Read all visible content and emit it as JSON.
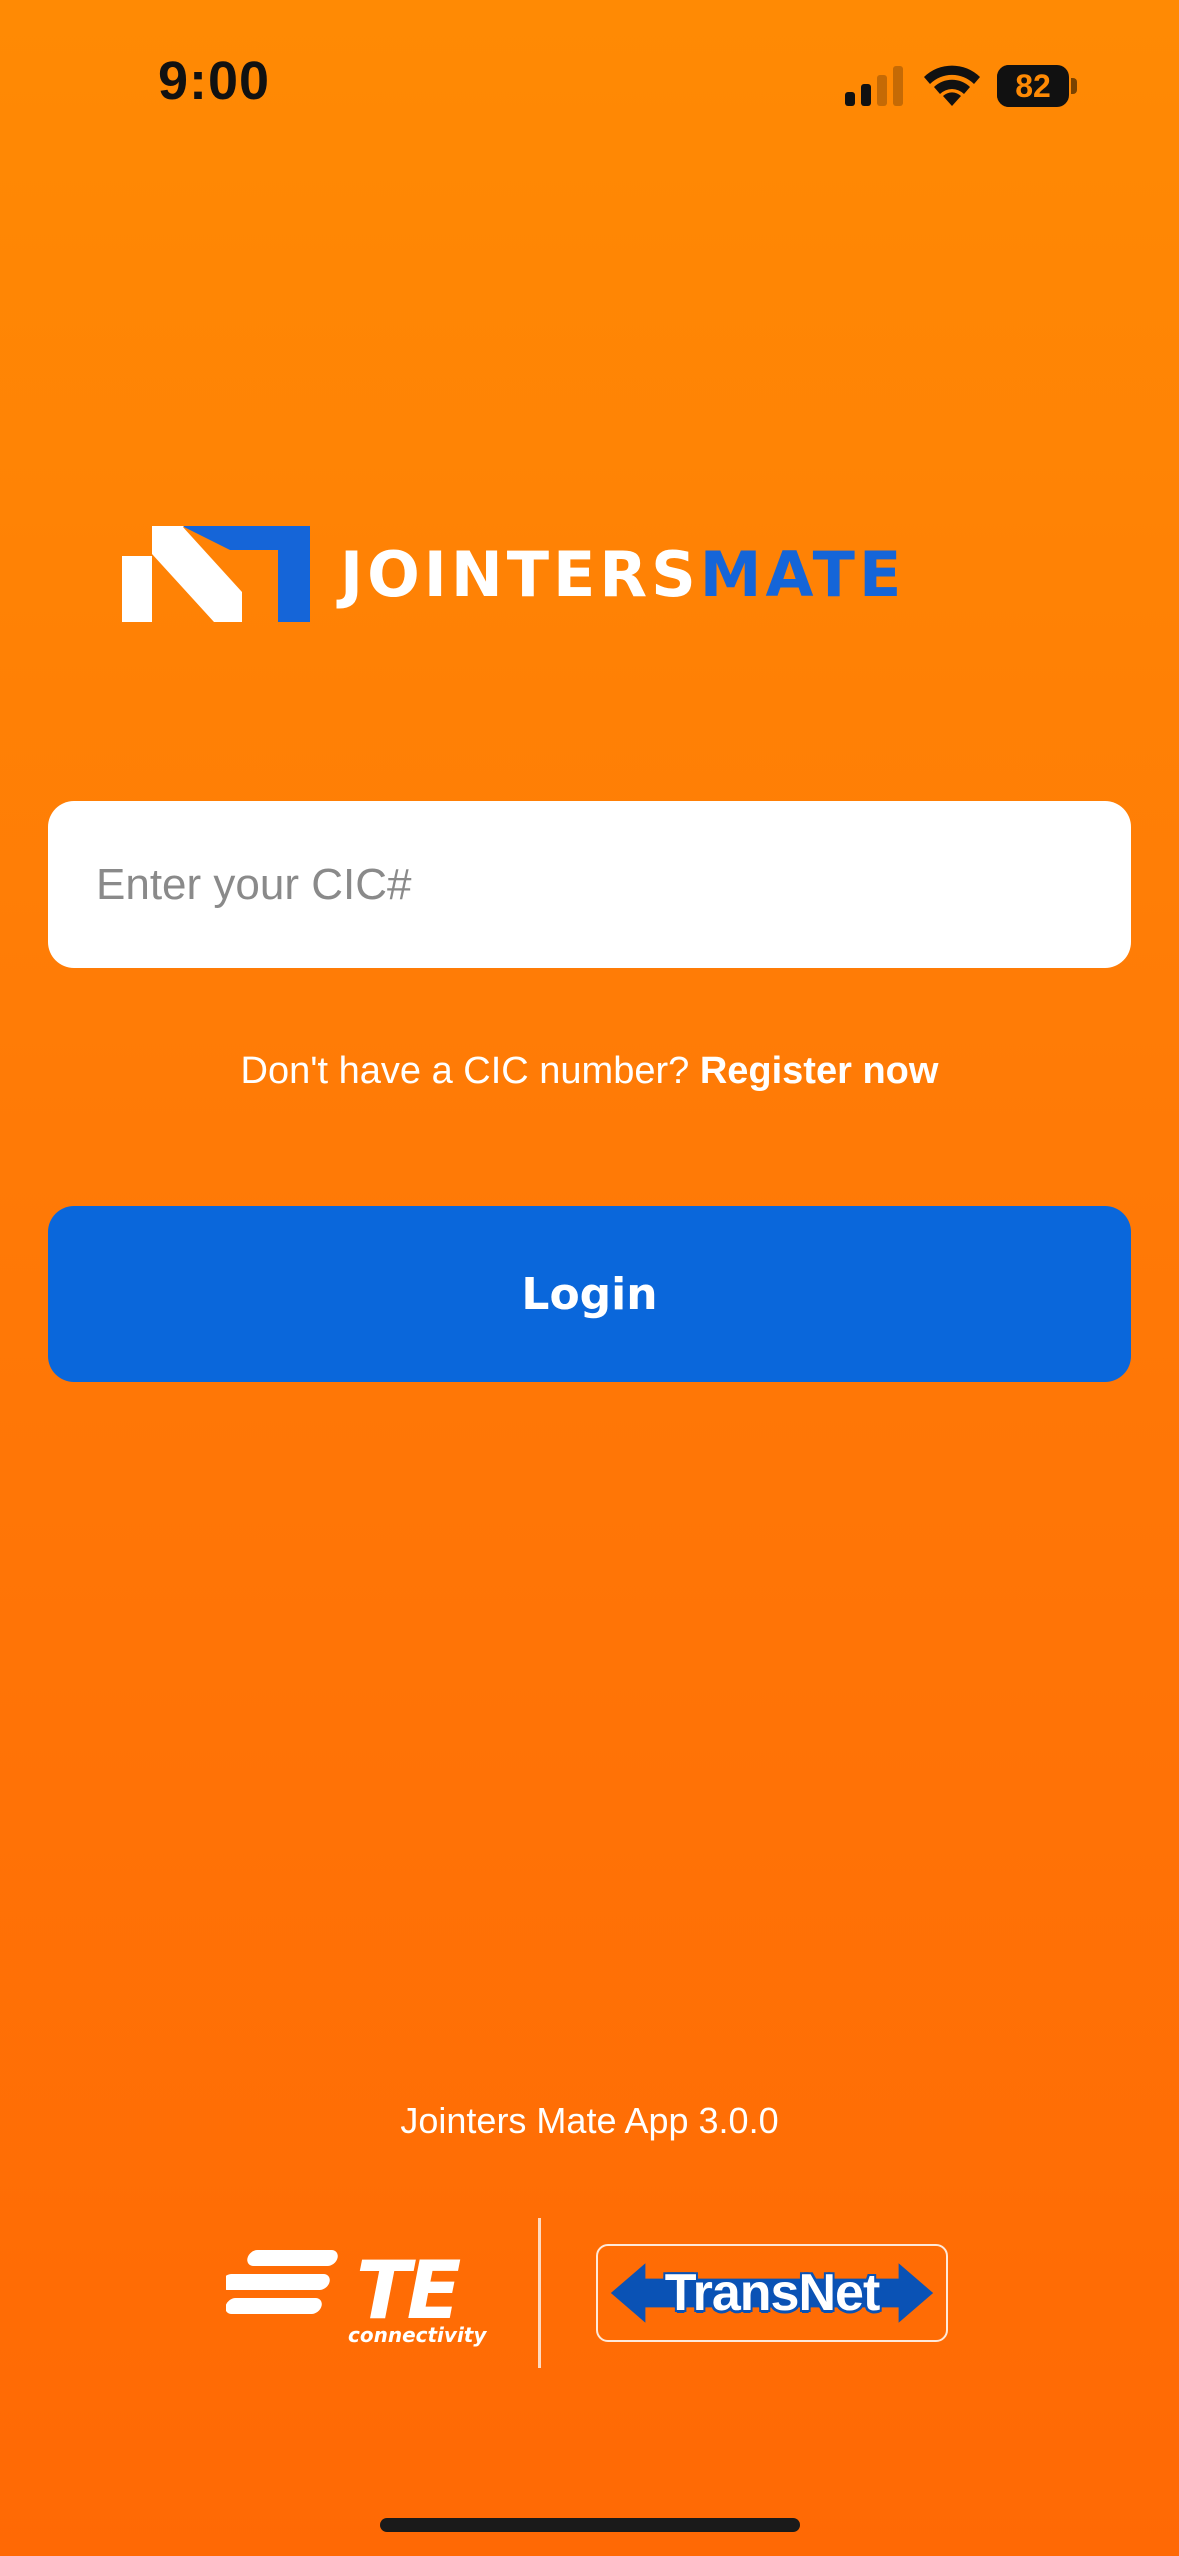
{
  "status_bar": {
    "time": "9:00",
    "battery_level": "82",
    "battery_fraction": 0.82,
    "icons": [
      "signal-icon",
      "wifi-icon",
      "battery-icon"
    ]
  },
  "logo": {
    "text_white": "JOINTERS",
    "text_blue": "MATE",
    "colors": {
      "white": "#FFFFFF",
      "blue": "#1565D8"
    }
  },
  "login_form": {
    "cic_placeholder": "Enter your CIC#",
    "cic_value": "",
    "register_prompt": "Don't have a CIC number?",
    "register_link": "Register now",
    "login_label": "Login"
  },
  "footer": {
    "app_version": "Jointers Mate App 3.0.0",
    "partners": {
      "te_text": "TE",
      "te_subtext": "connectivity",
      "transnet_text": "TransNet"
    }
  },
  "colors": {
    "background_top": "#FF8A04",
    "background_bottom": "#FF6905",
    "accent_blue": "#0A67DB",
    "text_white": "#FFFFFF"
  }
}
